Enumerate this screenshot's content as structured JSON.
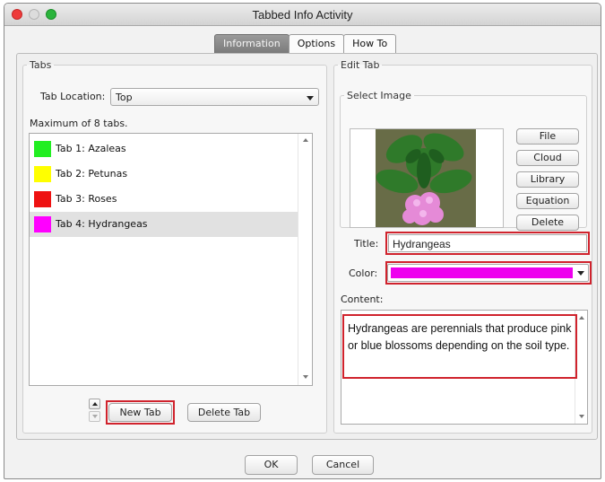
{
  "window": {
    "title": "Tabbed Info Activity"
  },
  "tabs": [
    {
      "label": "Information",
      "active": true
    },
    {
      "label": "Options",
      "active": false
    },
    {
      "label": "How To",
      "active": false
    }
  ],
  "tabs_group": {
    "legend": "Tabs",
    "location_label": "Tab Location:",
    "location_value": "Top",
    "max_note": "Maximum of 8 tabs.",
    "items": [
      {
        "label": "Tab 1: Azaleas",
        "color": "#22ee22",
        "selected": false
      },
      {
        "label": "Tab 2: Petunas",
        "color": "#ffff00",
        "selected": false
      },
      {
        "label": "Tab 3: Roses",
        "color": "#ee1111",
        "selected": false
      },
      {
        "label": "Tab 4: Hydrangeas",
        "color": "#ff00ff",
        "selected": true
      }
    ],
    "new_tab_label": "New Tab",
    "delete_tab_label": "Delete Tab"
  },
  "edit_tab": {
    "legend": "Edit Tab",
    "select_image_legend": "Select Image",
    "image_buttons": [
      "File",
      "Cloud",
      "Library",
      "Equation",
      "Delete"
    ],
    "title_label": "Title:",
    "title_value": "Hydrangeas",
    "color_label": "Color:",
    "color_value": "#ee00ee",
    "content_label": "Content:",
    "content_text": "Hydrangeas are perennials that produce pink or blue blossoms depending on the soil type."
  },
  "footer": {
    "ok_label": "OK",
    "cancel_label": "Cancel"
  }
}
